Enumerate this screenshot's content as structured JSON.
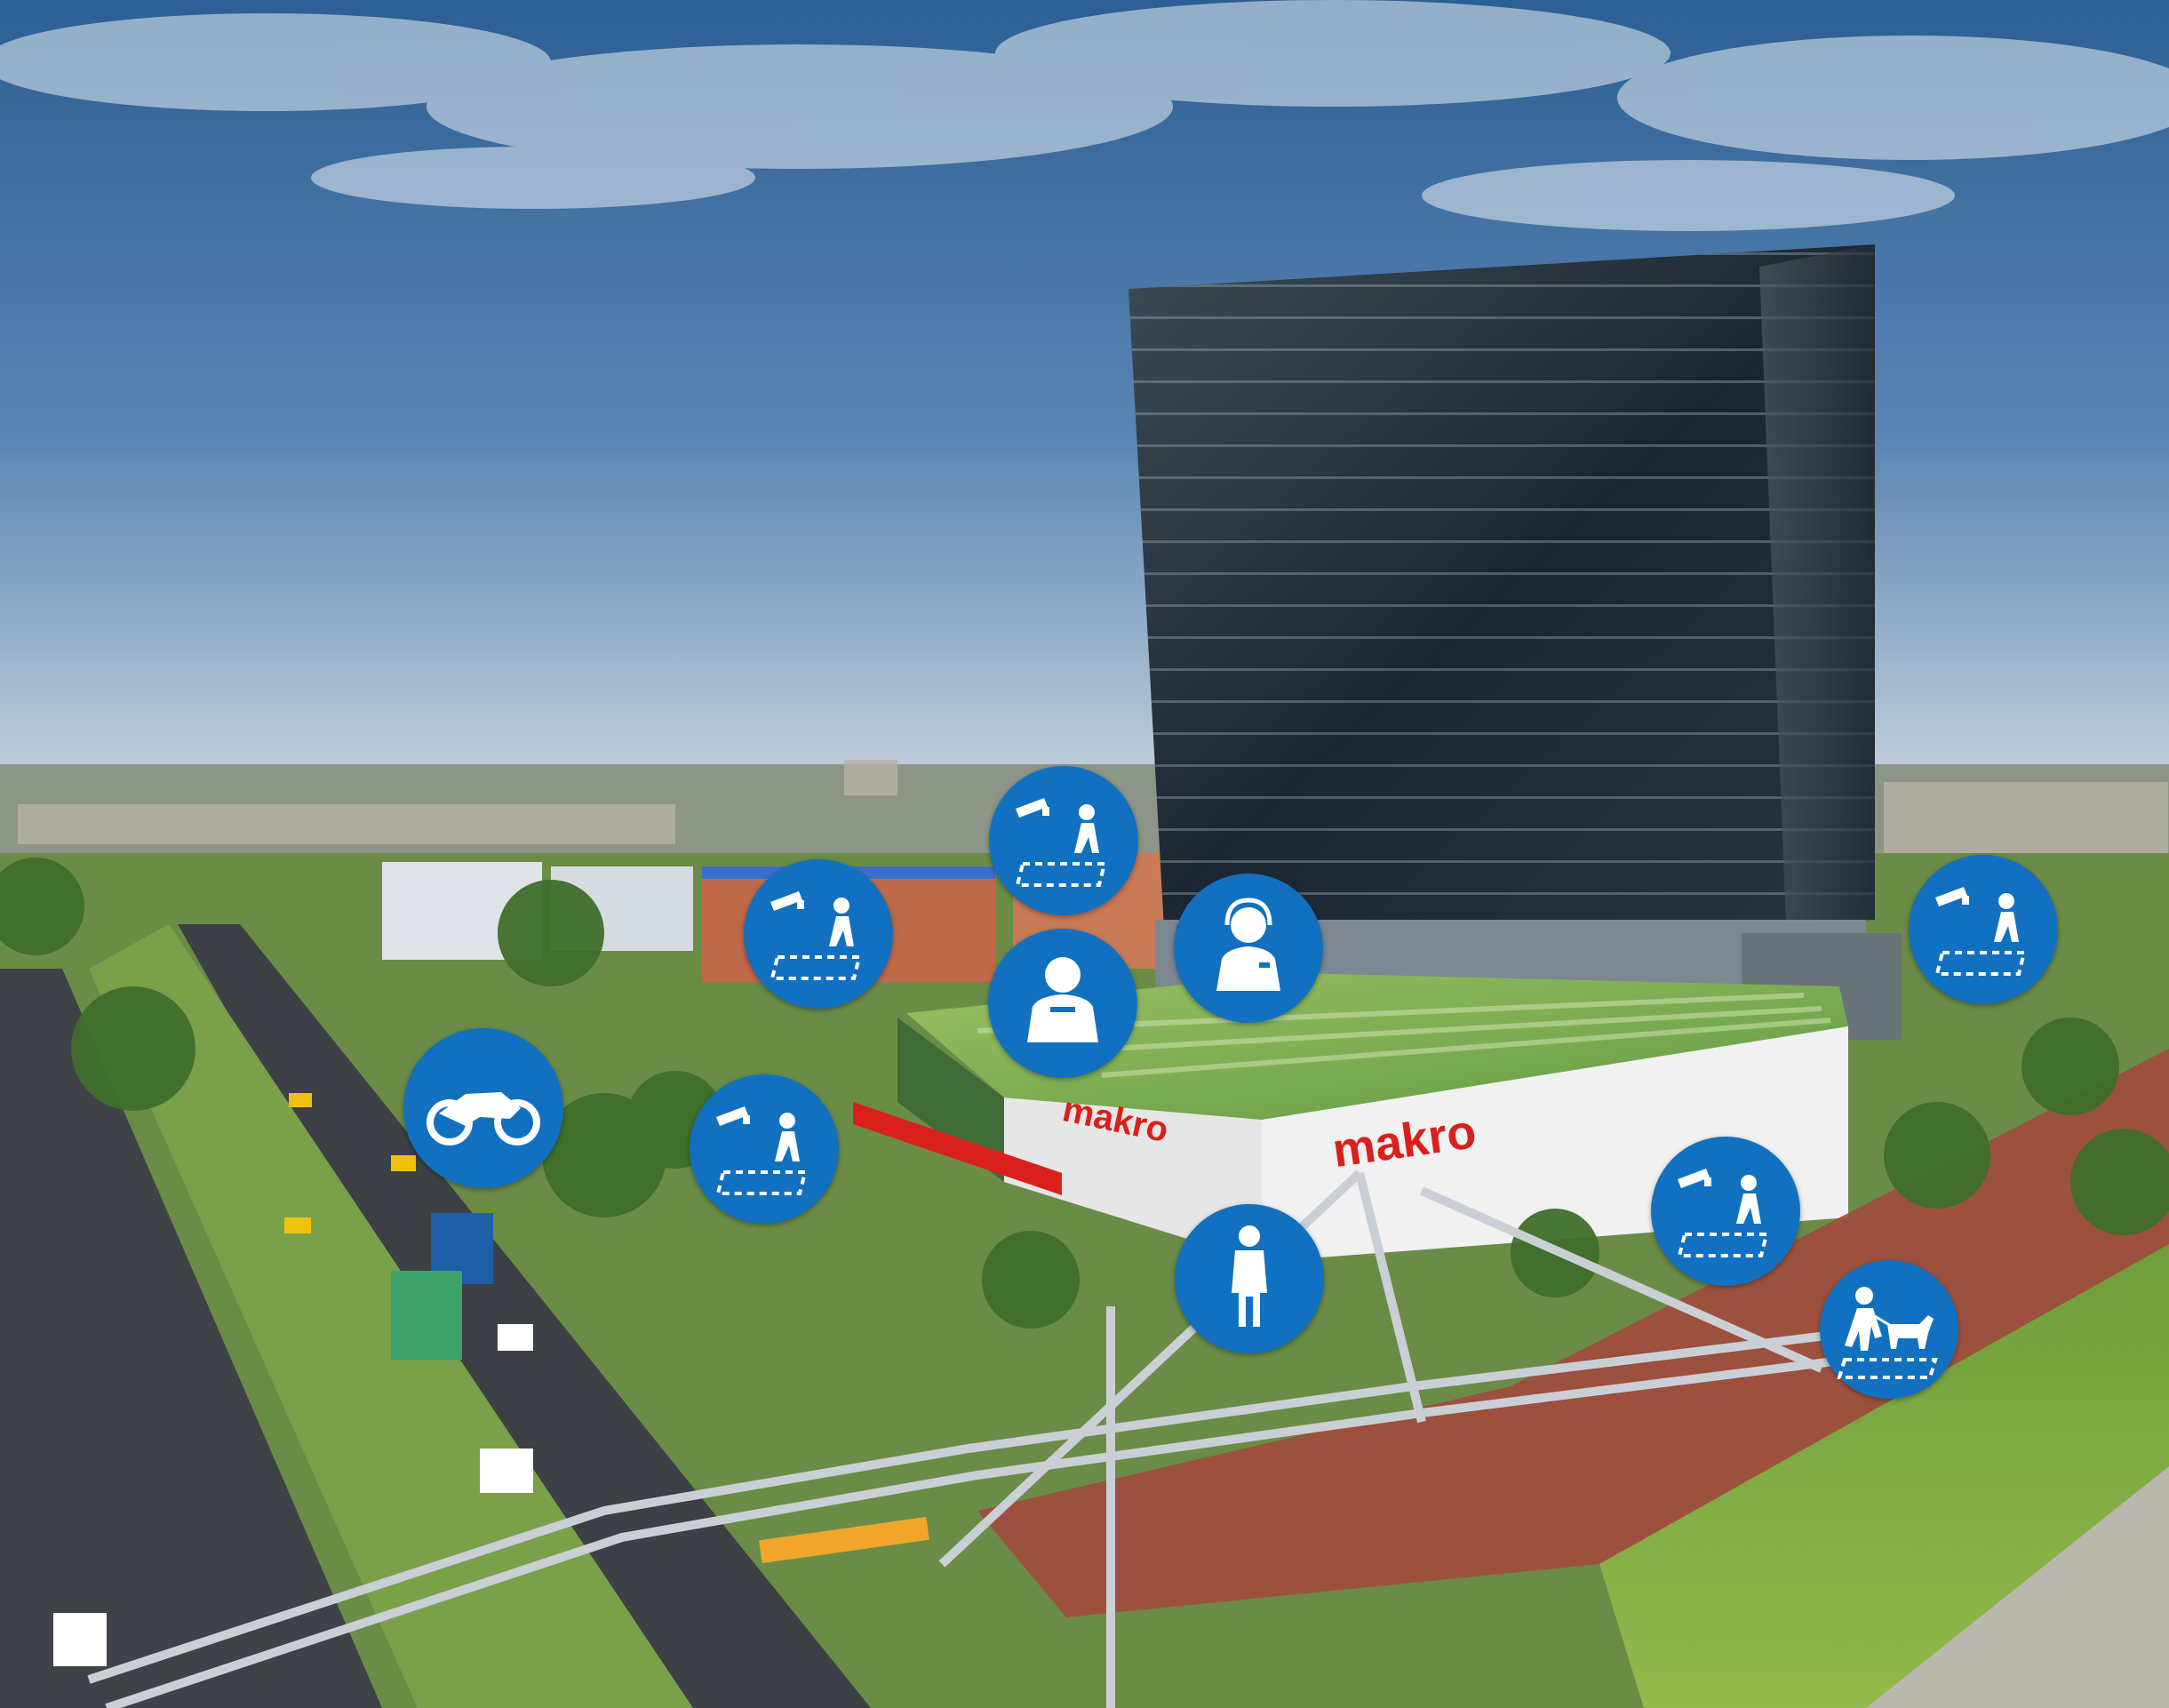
{
  "scene": {
    "signage": {
      "left": "makro",
      "right": "makro"
    },
    "colors": {
      "marker_blue": "#1171c0",
      "brand_red": "#d9201b",
      "sky_top": "#2c5f95",
      "sky_bottom": "#c7d3de"
    }
  },
  "markers": [
    {
      "icon": "security-camera-patrol-icon"
    },
    {
      "icon": "security-camera-patrol-icon"
    },
    {
      "icon": "security-guard-icon"
    },
    {
      "icon": "security-operator-headset-icon"
    },
    {
      "icon": "security-camera-patrol-icon"
    },
    {
      "icon": "motorcycle-patrol-icon"
    },
    {
      "icon": "security-camera-patrol-icon"
    },
    {
      "icon": "standing-guard-icon"
    },
    {
      "icon": "security-camera-patrol-icon"
    },
    {
      "icon": "k9-unit-patrol-icon"
    }
  ]
}
